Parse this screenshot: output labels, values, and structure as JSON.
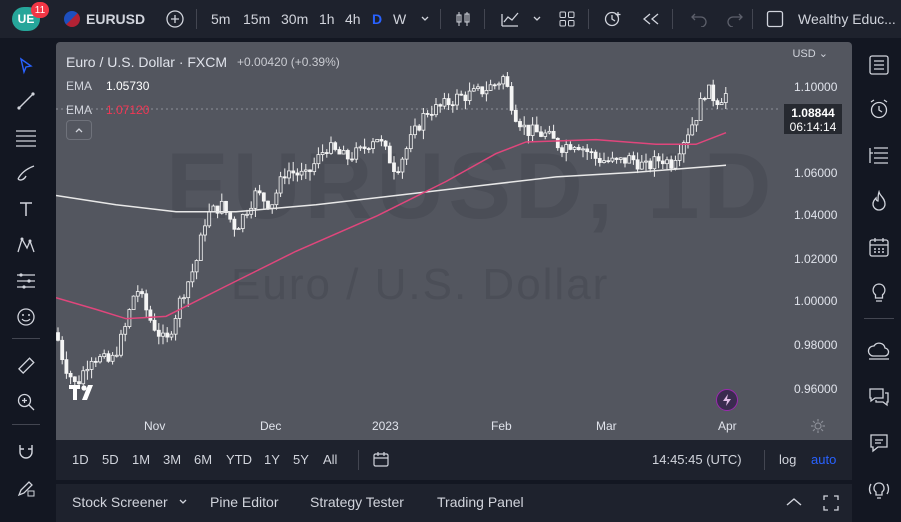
{
  "topbar": {
    "notification_count": "11",
    "symbol": "EURUSD",
    "timeframes": [
      "5m",
      "15m",
      "30m",
      "1h",
      "4h",
      "D",
      "W"
    ],
    "active_timeframe": "D",
    "account": "Wealthy Educ..."
  },
  "legend": {
    "title": "Euro / U.S. Dollar · FXCM",
    "change": "+0.00420 (+0.39%)",
    "ema1_label": "EMA",
    "ema1_value": "1.05730",
    "ema2_label": "EMA",
    "ema2_value": "1.07120"
  },
  "watermark": {
    "symbol": "EURUSD, 1D",
    "name": "Euro / U.S. Dollar"
  },
  "price_axis": {
    "currency": "USD",
    "last_price": "1.08844",
    "countdown": "06:14:14",
    "labels": [
      "1.10000",
      "1.06000",
      "1.04000",
      "1.02000",
      "1.00000",
      "0.98000",
      "0.96000"
    ]
  },
  "time_axis": {
    "labels": [
      "Nov",
      "Dec",
      "2023",
      "Feb",
      "Mar",
      "Apr"
    ]
  },
  "rangebar": {
    "ranges": [
      "1D",
      "5D",
      "1M",
      "3M",
      "6M",
      "YTD",
      "1Y",
      "5Y",
      "All"
    ],
    "clock": "14:45:45 (UTC)",
    "log": "log",
    "auto": "auto"
  },
  "bottombar": {
    "tabs": [
      "Stock Screener",
      "Pine Editor",
      "Strategy Tester",
      "Trading Panel"
    ]
  },
  "chart_data": {
    "type": "candlestick",
    "x_axis": [
      "Nov",
      "Dec",
      "2023",
      "Feb",
      "Mar",
      "Apr"
    ],
    "ylim": [
      0.95,
      1.11
    ],
    "ema_fast": 1.0712,
    "ema_slow": 1.0573,
    "last_price": 1.08844
  },
  "colors": {
    "background": "#131722",
    "chart_bg": "#53565f",
    "ema_fast": "#e0467c",
    "ema_slow": "#e8e8e8",
    "accent": "#2962ff"
  }
}
